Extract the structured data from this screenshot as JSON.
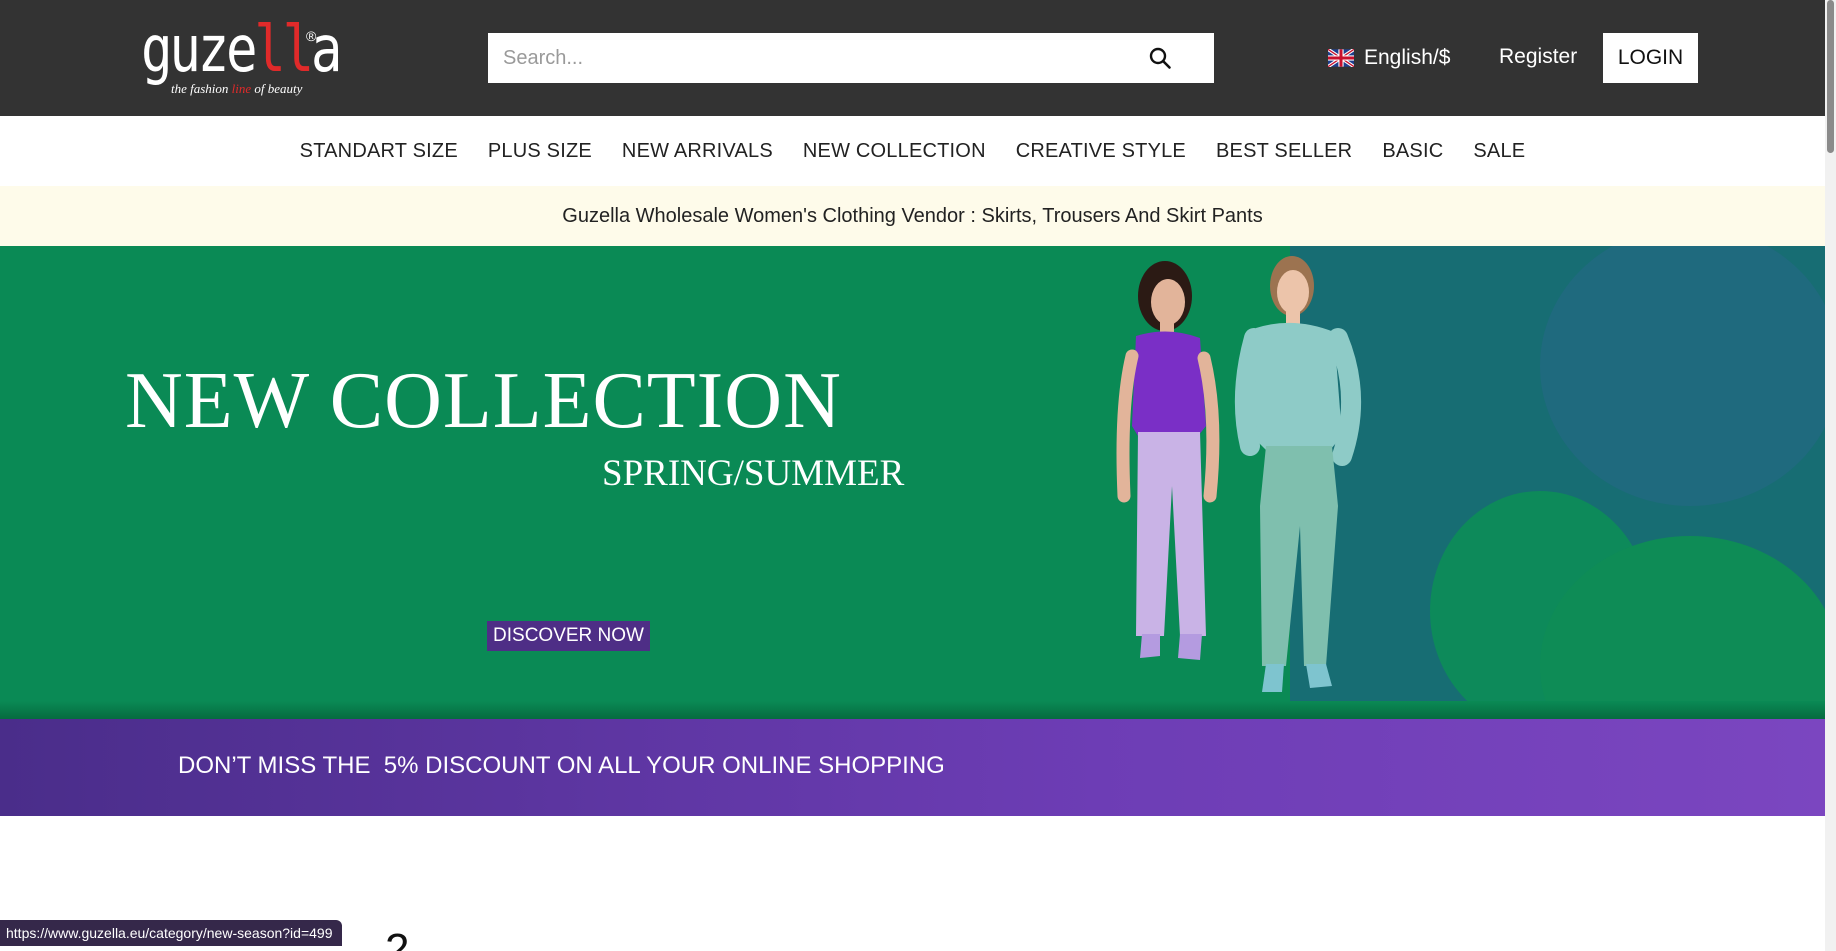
{
  "brand": {
    "logo_word": "guze",
    "logo_word_accent": "ll",
    "logo_word_end": "a",
    "registered": "®",
    "tagline_a": "the fashion ",
    "tagline_b": "line",
    "tagline_c": " of beauty"
  },
  "search": {
    "placeholder": "Search...",
    "value": ""
  },
  "header": {
    "language": "English/$",
    "register": "Register",
    "login": "LOGIN"
  },
  "nav": {
    "items": [
      "STANDART SIZE",
      "PLUS SIZE",
      "NEW ARRIVALS",
      "NEW COLLECTION",
      "CREATIVE STYLE",
      "BEST SELLER",
      "BASIC",
      "SALE"
    ]
  },
  "info_strip": {
    "text": "Guzella Wholesale Women's Clothing Vendor : Skirts, Trousers And Skirt Pants"
  },
  "banner": {
    "title": "NEW COLLECTION",
    "subtitle": "SPRING/SUMMER",
    "cta": "DISCOVER NOW",
    "promo": "DON’T MISS THE  5% DISCOUNT ON ALL YOUR ONLINE SHOPPING"
  },
  "status_bar": {
    "url": "https://www.guzella.eu/category/new-season?id=499"
  },
  "below_fold": {
    "partial_glyph": "2"
  },
  "colors": {
    "topbar": "#333333",
    "banner_green": "#0a8a55",
    "banner_purple": "#6d3db5",
    "cta_purple": "#4e2e86",
    "strip": "#fefbea",
    "logo_red": "#e02a2a"
  },
  "icons": {
    "search": "search-icon",
    "flag": "uk-flag-icon"
  }
}
